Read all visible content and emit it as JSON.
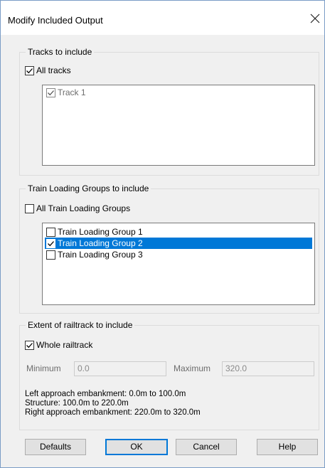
{
  "dialog": {
    "title": "Modify Included Output"
  },
  "tracks": {
    "legend": "Tracks to include",
    "all_label": "All tracks",
    "all_checked": true,
    "items": [
      {
        "label": "Track 1",
        "checked": true,
        "disabled": true
      }
    ]
  },
  "groups": {
    "legend": "Train Loading Groups to include",
    "all_label": "All Train Loading Groups",
    "all_checked": false,
    "items": [
      {
        "label": "Train Loading Group 1",
        "checked": false,
        "selected": false
      },
      {
        "label": "Train Loading Group 2",
        "checked": true,
        "selected": true
      },
      {
        "label": "Train Loading Group 3",
        "checked": false,
        "selected": false
      }
    ]
  },
  "extent": {
    "legend": "Extent of railtrack to include",
    "whole_label": "Whole railtrack",
    "whole_checked": true,
    "minimum_label": "Minimum",
    "minimum_value": "0.0",
    "maximum_label": "Maximum",
    "maximum_value": "320.0",
    "info": [
      "Left approach embankment: 0.0m to 100.0m",
      "Structure: 100.0m to 220.0m",
      "Right approach embankment: 220.0m to 320.0m"
    ]
  },
  "buttons": {
    "defaults": "Defaults",
    "ok": "OK",
    "cancel": "Cancel",
    "help": "Help"
  },
  "colors": {
    "selection": "#0078d7",
    "default_button_border": "#0078d7"
  },
  "icons": {
    "close": "close-icon",
    "check": "check-icon"
  }
}
